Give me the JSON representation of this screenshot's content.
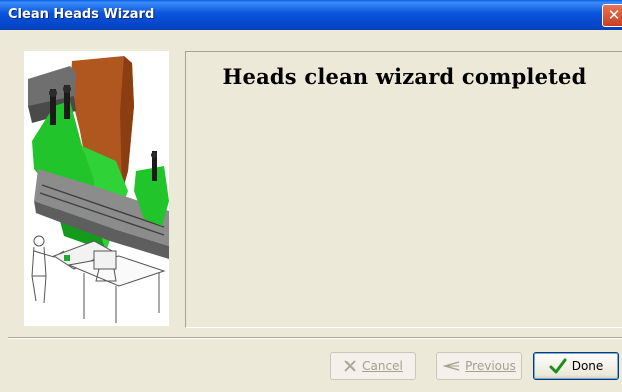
{
  "window": {
    "title": "Clean Heads Wizard",
    "close_icon": "close-icon"
  },
  "main": {
    "title": "Heads clean wizard completed"
  },
  "buttons": {
    "cancel": {
      "label": "Cancel",
      "icon": "x-cancel-icon",
      "enabled": false
    },
    "previous": {
      "label": "Previous",
      "icon": "back-arrow-icon",
      "enabled": false
    },
    "done": {
      "label": "Done",
      "icon": "checkmark-icon",
      "enabled": true
    }
  },
  "colors": {
    "titlebar": "#0a53db",
    "dialog_bg": "#ece9d8",
    "done_check": "#1c8f1c"
  }
}
